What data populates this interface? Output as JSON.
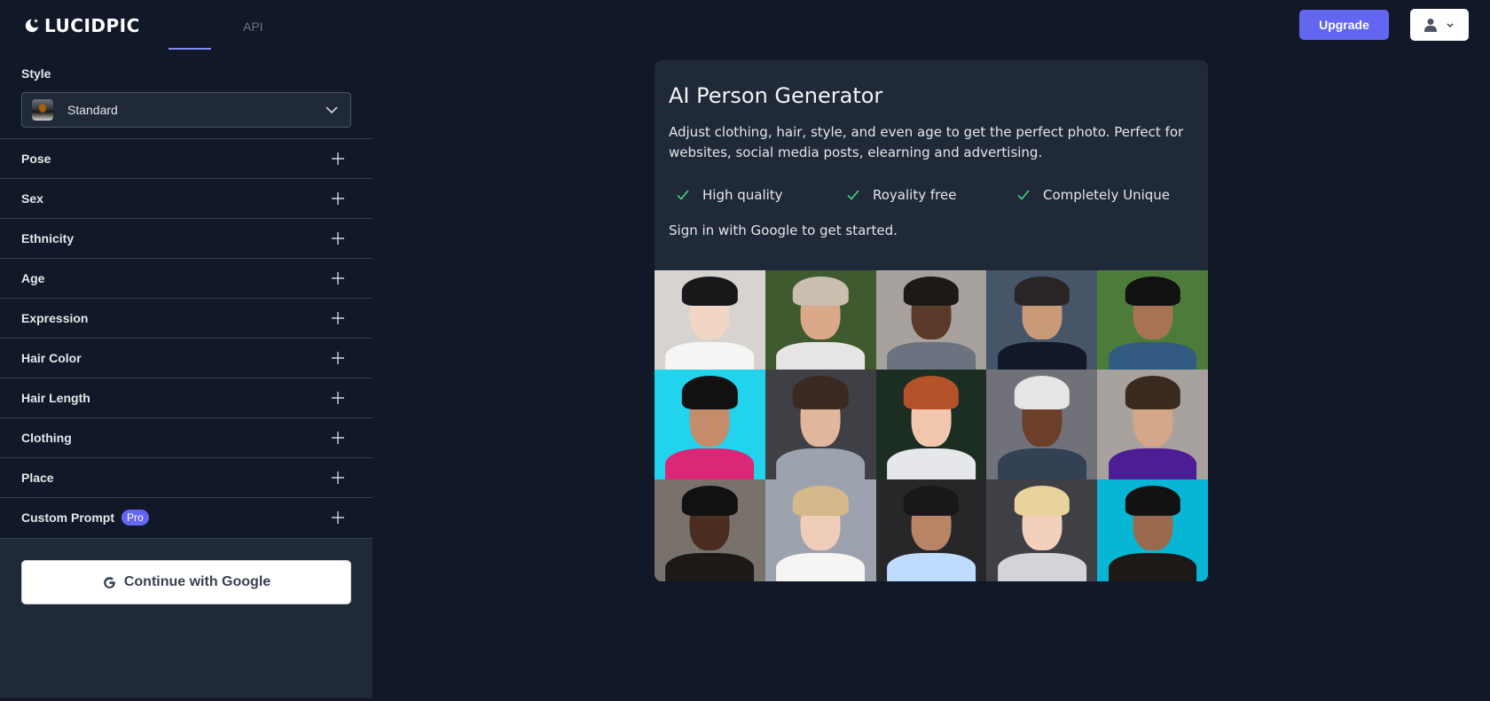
{
  "header": {
    "logo_text": "LUCIDPIC",
    "tabs": [
      {
        "label": "",
        "active": true
      },
      {
        "label": "API",
        "active": false
      }
    ],
    "upgrade_label": "Upgrade",
    "accent_color": "#6366f1"
  },
  "sidebar": {
    "style_label": "Style",
    "style_value": "Standard",
    "options": [
      {
        "label": "Pose"
      },
      {
        "label": "Sex"
      },
      {
        "label": "Ethnicity"
      },
      {
        "label": "Age"
      },
      {
        "label": "Expression"
      },
      {
        "label": "Hair Color"
      },
      {
        "label": "Hair Length"
      },
      {
        "label": "Clothing"
      },
      {
        "label": "Place"
      },
      {
        "label": "Custom Prompt",
        "badge": "Pro"
      }
    ],
    "google_button_label": "Continue with Google"
  },
  "main": {
    "title": "AI Person Generator",
    "description": "Adjust clothing, hair, style, and even age to get the perfect photo. Perfect for websites, social media posts, elearning and advertising.",
    "features": [
      "High quality",
      "Royality free",
      "Completely Unique"
    ],
    "check_color": "#4ade80",
    "signin_text": "Sign in with Google to get started.",
    "gallery": [
      {
        "desc": "asian-woman-white-lace",
        "bg": "#d6d3d1",
        "skin": "#f1d6c6",
        "hair": "#18181b",
        "cloth": "#f5f5f4"
      },
      {
        "desc": "older-man-white-blazer",
        "bg": "#3f5a2e",
        "skin": "#d9a98a",
        "hair": "#c8bfae",
        "cloth": "#e7e5e4"
      },
      {
        "desc": "black-man-grey-suit",
        "bg": "#a8a29e",
        "skin": "#5b3a29",
        "hair": "#1c1917",
        "cloth": "#6b7280"
      },
      {
        "desc": "older-asian-man",
        "bg": "#475569",
        "skin": "#c99a7a",
        "hair": "#292524",
        "cloth": "#111827"
      },
      {
        "desc": "bearded-man-green-bg",
        "bg": "#4d7c3a",
        "skin": "#a87355",
        "hair": "#111111",
        "cloth": "#335a80"
      },
      {
        "desc": "woman-colorful-makeup",
        "bg": "#22d3ee",
        "skin": "#c48c6a",
        "hair": "#111111",
        "cloth": "#db2777"
      },
      {
        "desc": "asian-woman-grey-blazer",
        "bg": "#3f3f46",
        "skin": "#e0b79c",
        "hair": "#3b2a22",
        "cloth": "#9ca3af"
      },
      {
        "desc": "redhead-woman-bokeh",
        "bg": "#1c2d22",
        "skin": "#f1c8ae",
        "hair": "#b4532a",
        "cloth": "#e5e7eb"
      },
      {
        "desc": "older-black-man-mustache",
        "bg": "#71717a",
        "skin": "#6b3f2a",
        "hair": "#e5e5e5",
        "cloth": "#334155"
      },
      {
        "desc": "woman-long-brown-hair",
        "bg": "#a8a29e",
        "skin": "#d4a78a",
        "hair": "#3b2a20",
        "cloth": "#4c1d95"
      },
      {
        "desc": "black-woman-curly-hair",
        "bg": "#78716c",
        "skin": "#4a2c20",
        "hair": "#111111",
        "cloth": "#1c1917"
      },
      {
        "desc": "blonde-woman-white-blazer",
        "bg": "#9ca3af",
        "skin": "#f0cdb8",
        "hair": "#d6b98a",
        "cloth": "#f5f5f4"
      },
      {
        "desc": "man-light-blue-shirt",
        "bg": "#27272a",
        "skin": "#b98466",
        "hair": "#18181b",
        "cloth": "#bfdbfe"
      },
      {
        "desc": "blonde-woman-sweater",
        "bg": "#3f3f46",
        "skin": "#f2d0bc",
        "hair": "#e8d39c",
        "cloth": "#d4d4d8"
      },
      {
        "desc": "men-embroidered-jacket-cyan",
        "bg": "#06b6d4",
        "skin": "#9a6a4c",
        "hair": "#111111",
        "cloth": "#1c1917"
      }
    ]
  }
}
